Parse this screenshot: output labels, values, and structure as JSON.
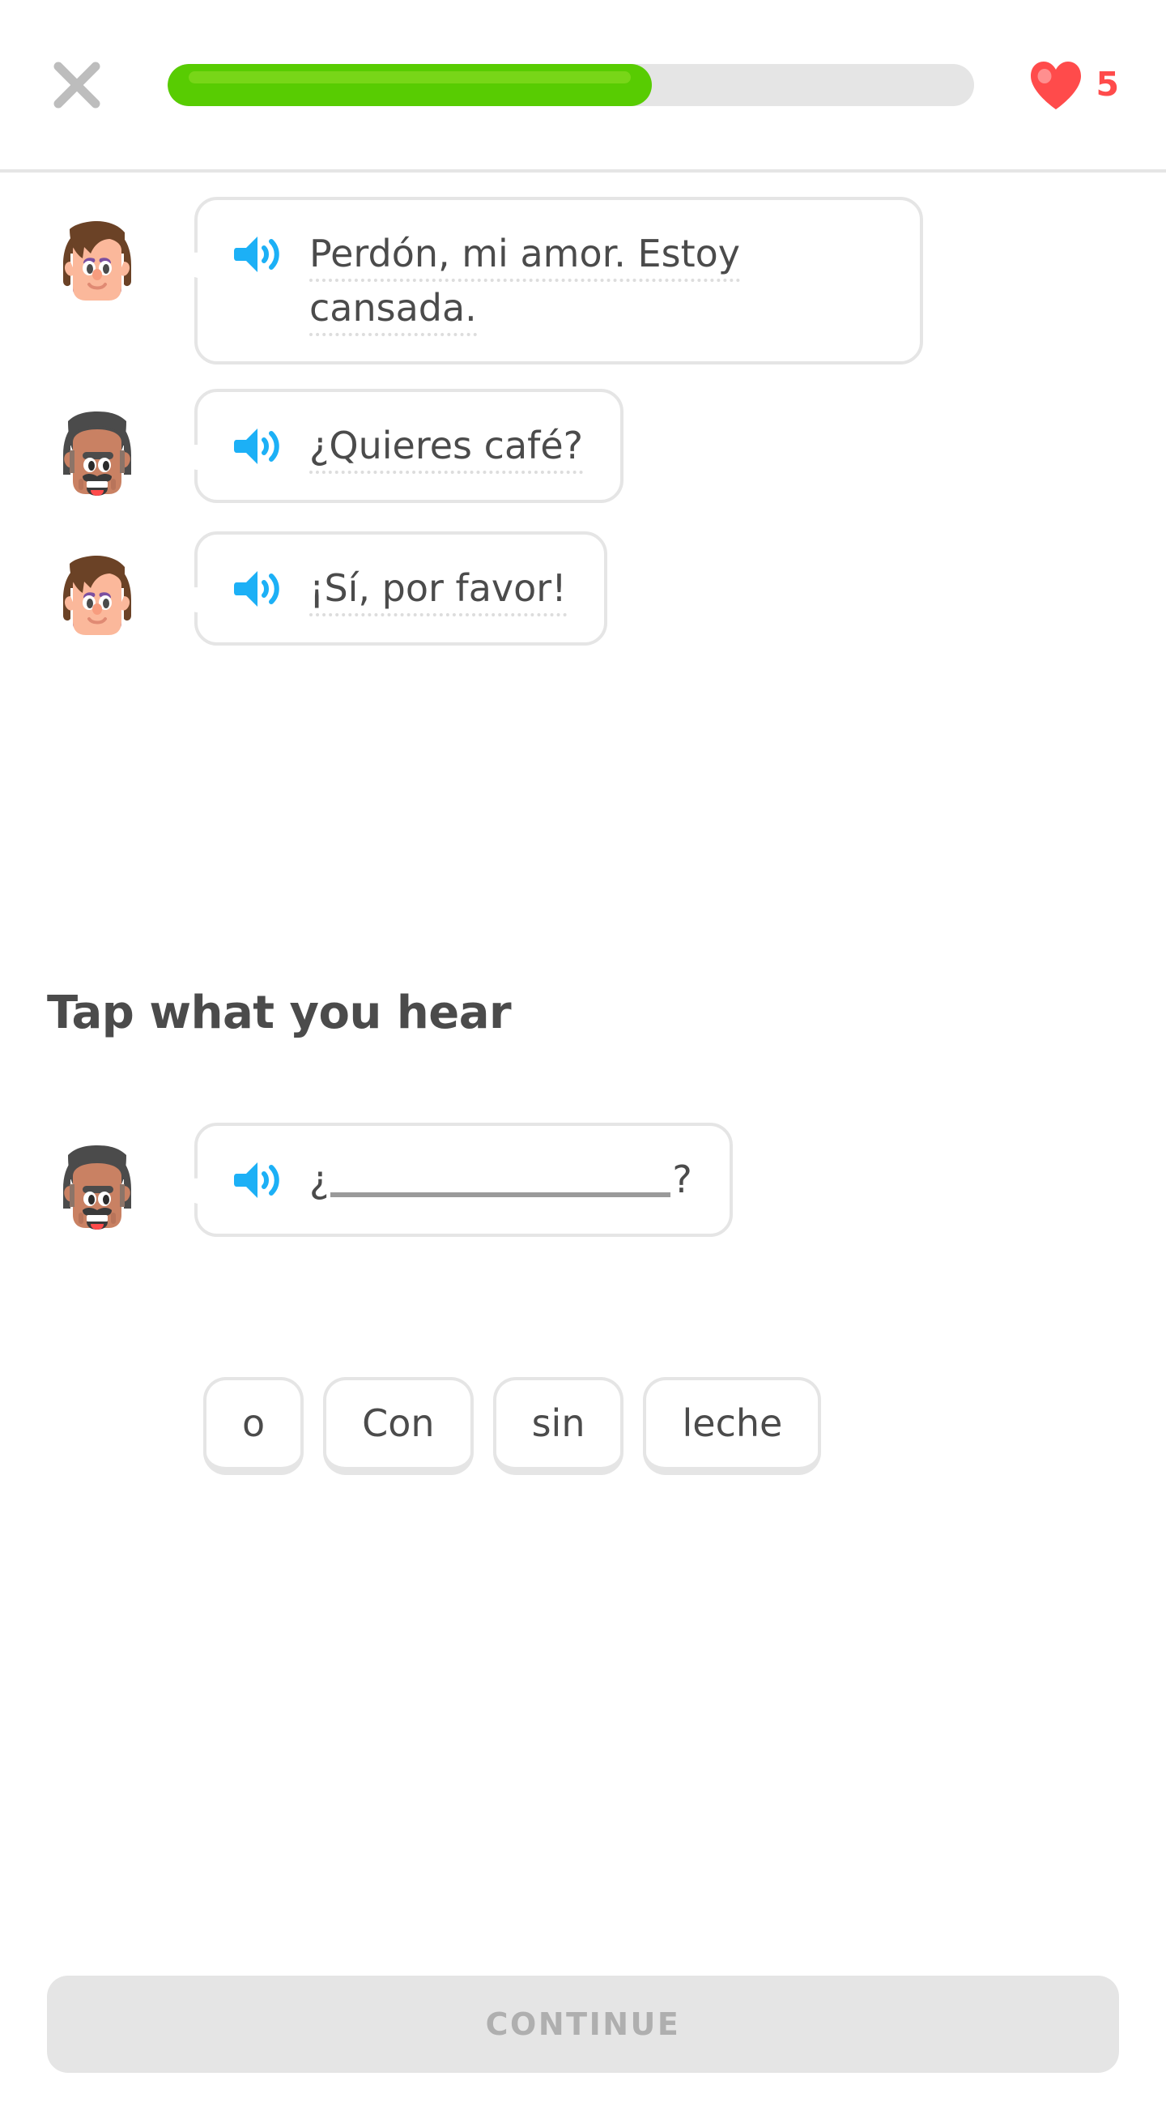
{
  "header": {
    "close_label": "close-lesson",
    "progress_percent": 60,
    "hearts_count": "5",
    "heart_color": "#FF4B4B",
    "progress_fill_color": "#58CC02",
    "progress_track_color": "#E5E5E5"
  },
  "dialogue": [
    {
      "speaker": "lily",
      "avatar": "female-brown-hair-avatar",
      "audio_icon": "speaker-icon",
      "text": "Perdón, mi amor. Estoy cansada."
    },
    {
      "speaker": "oscar",
      "avatar": "male-gray-hair-mustache-avatar",
      "audio_icon": "speaker-icon",
      "text": "¿Quieres café?"
    },
    {
      "speaker": "lily",
      "avatar": "female-brown-hair-avatar",
      "audio_icon": "speaker-icon",
      "text": "¡Sí, por favor!"
    }
  ],
  "exercise": {
    "instruction": "Tap what you hear",
    "challenge": {
      "speaker": "oscar",
      "avatar": "male-gray-hair-mustache-avatar",
      "audio_icon": "speaker-icon",
      "prefix": "¿",
      "suffix": "?",
      "blank_filled": ""
    },
    "token_bank": [
      {
        "label": "o"
      },
      {
        "label": "Con"
      },
      {
        "label": "sin"
      },
      {
        "label": "leche"
      }
    ]
  },
  "footer": {
    "continue_label": "CONTINUE",
    "continue_enabled": false
  },
  "colors": {
    "text": "#4B4B4B",
    "border": "#E5E5E5",
    "audio_blue": "#1CB0F6",
    "disabled_text": "#AFAFAF"
  }
}
